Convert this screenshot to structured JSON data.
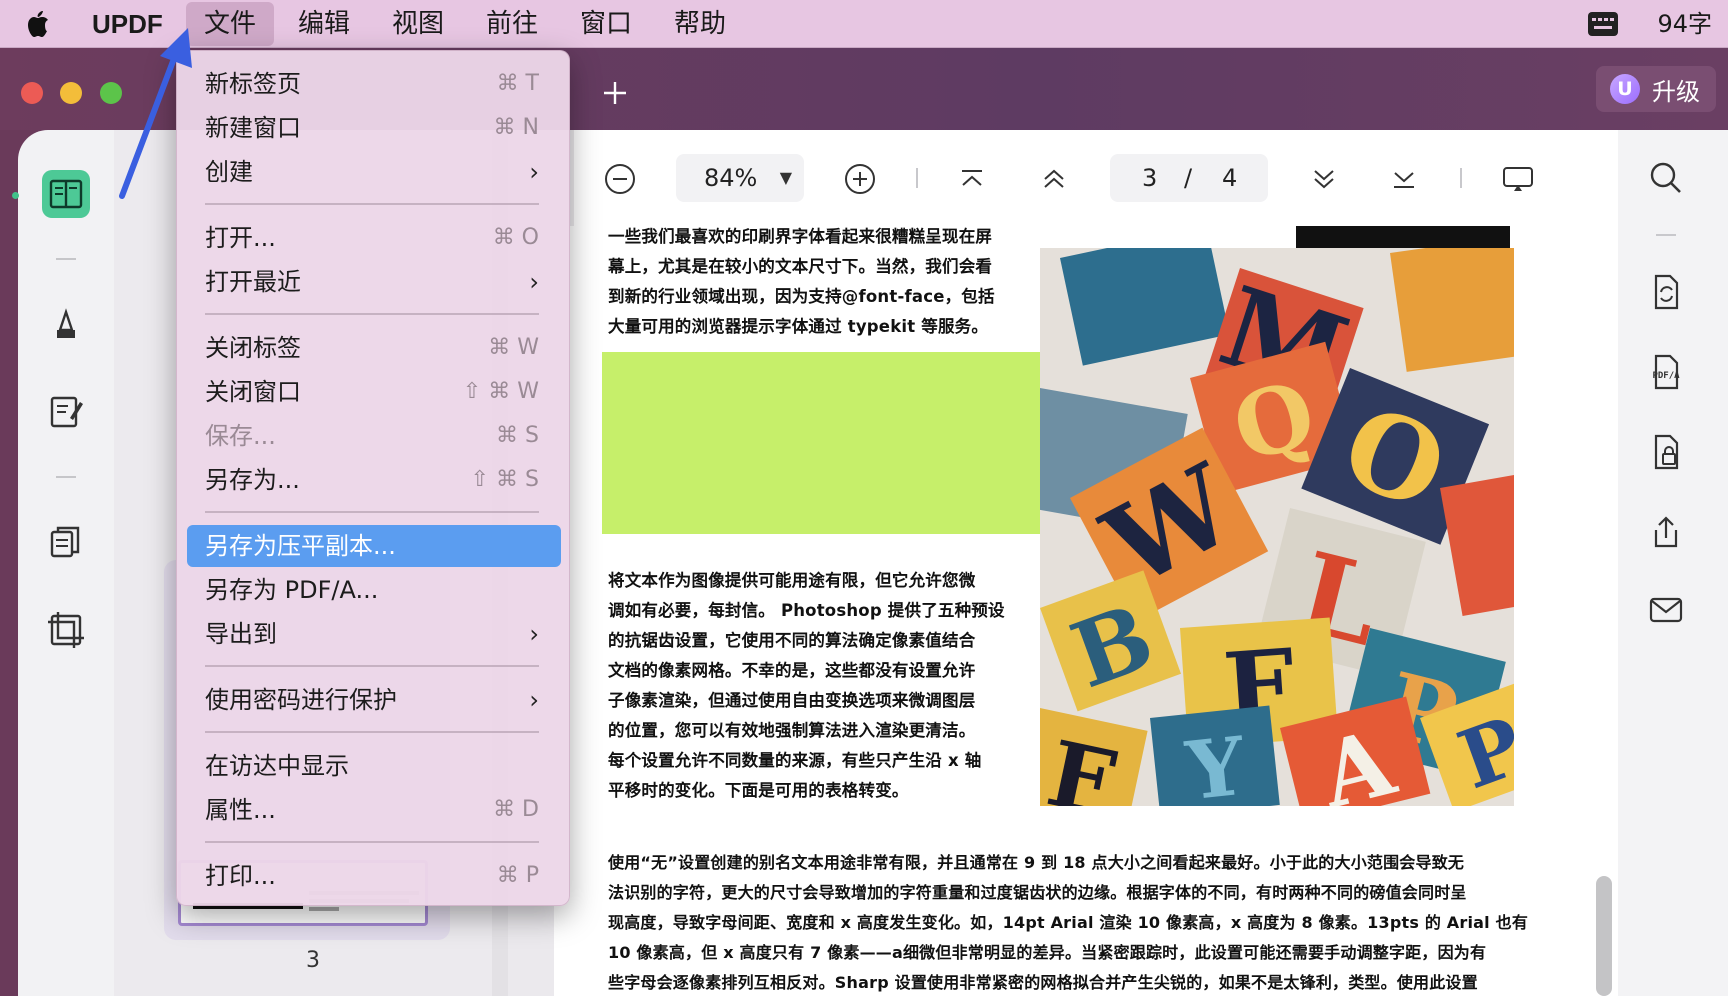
{
  "menubar": {
    "app_name": "UPDF",
    "items": [
      "文件",
      "编辑",
      "视图",
      "前往",
      "窗口",
      "帮助"
    ],
    "word_count": "94字"
  },
  "window": {
    "upgrade_badge": "U",
    "upgrade_label": "升级"
  },
  "toolbar": {
    "zoom": "84%",
    "current_page": "3",
    "page_separator": "/",
    "total_pages": "4"
  },
  "thumbnail": {
    "page_number": "3"
  },
  "file_menu": {
    "items": [
      {
        "label": "新标签页",
        "shortcut": "⌘ T"
      },
      {
        "label": "新建窗口",
        "shortcut": "⌘ N"
      },
      {
        "label": "创建",
        "submenu": "›"
      },
      {
        "label": "打开...",
        "shortcut": "⌘ O"
      },
      {
        "label": "打开最近",
        "submenu": "›"
      },
      {
        "label": "关闭标签",
        "shortcut": "⌘ W"
      },
      {
        "label": "关闭窗口",
        "shortcut": "⇧ ⌘ W"
      },
      {
        "label": "保存...",
        "shortcut": "⌘ S"
      },
      {
        "label": "另存为...",
        "shortcut": "⇧ ⌘ S"
      },
      {
        "label": "另存为压平副本..."
      },
      {
        "label": "另存为 PDF/A..."
      },
      {
        "label": "导出到",
        "submenu": "›"
      },
      {
        "label": "使用密码进行保护",
        "submenu": "›"
      },
      {
        "label": "在访达中显示"
      },
      {
        "label": "属性...",
        "shortcut": "⌘ D"
      },
      {
        "label": "打印...",
        "shortcut": "⌘ P"
      }
    ]
  },
  "document": {
    "para1": [
      "一些我们最喜欢的印刷界字体看起来很糟糕呈现在屏",
      "幕上，尤其是在较小的文本尺寸下。当然，我们会看",
      "到新的行业领域出现，因为支持@font-face，包括",
      "大量可用的浏览器提示字体通过 typekit 等服务。"
    ],
    "para2": [
      "将文本作为图像提供可能用途有限，但它允许您微",
      "调如有必要，每封信。 Photoshop 提供了五种预设",
      "的抗锯齿设置，它使用不同的算法确定像素值结合",
      "文档的像素网格。不幸的是，这些都没有设置允许",
      "子像素渲染，但通过使用自由变换选项来微调图层",
      "的位置，您可以有效地强制算法进入渲染更清洁。",
      "每个设置允许不同数量的来源，有些只产生沿 x 轴",
      "平移时的变化。下面是可用的表格转变。"
    ],
    "para3": [
      "使用“无”设置创建的别名文本用途非常有限，并且通常在 9 到 18 点大小之间看起来最好。小于此的大小范围会导致无",
      "法识别的字符，更大的尺寸会导致增加的字符重量和过度锯齿状的边缘。根据字体的不同，有时两种不同的磅值会同时呈",
      "现高度，导致字母间距、宽度和 x 高度发生变化。如，14pt Arial 渲染 10 像素高，x 高度为 8 像素。13pts 的 Arial 也有",
      "10 像素高，但 x 高度只有 7 像素——a细微但非常明显的差异。当紧密跟踪时，此设置可能还需要手动调整字距，因为有",
      "些字母会逐像素排列互相反对。Sharp 设置使用非常紧密的网格拟合并产生尖锐的，如果不是太锋利，类型。使用此设置"
    ],
    "photo_letters": [
      "M",
      "O",
      "Q",
      "W",
      "L",
      "B",
      "F",
      "F",
      "Y",
      "A",
      "P",
      "P"
    ]
  },
  "colors": {
    "menubar_bg": "#e7c6e2",
    "highlight": "#5b9df0",
    "active_tool": "#4dc996",
    "green_block": "#c6ef6a"
  }
}
